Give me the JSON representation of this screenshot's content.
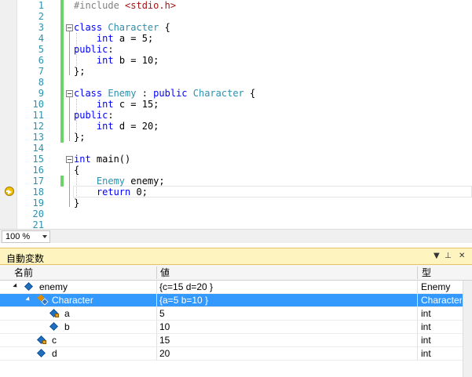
{
  "editor": {
    "lines": [
      {
        "n": "1",
        "segs": [
          {
            "t": "#include ",
            "c": "#808080"
          },
          {
            "t": "<stdio.h>",
            "c": "#a31515"
          }
        ]
      },
      {
        "n": "2",
        "segs": []
      },
      {
        "n": "3",
        "segs": [
          {
            "t": "class ",
            "c": "#0000ff"
          },
          {
            "t": "Character",
            "c": "#2b91af"
          },
          {
            "t": " {",
            "c": "#000000"
          }
        ]
      },
      {
        "n": "4",
        "segs": [
          {
            "t": "    ",
            "c": "#000000"
          },
          {
            "t": "int",
            "c": "#0000ff"
          },
          {
            "t": " a = 5;",
            "c": "#000000"
          }
        ]
      },
      {
        "n": "5",
        "segs": [
          {
            "t": "public",
            "c": "#0000ff"
          },
          {
            "t": ":",
            "c": "#000000"
          }
        ]
      },
      {
        "n": "6",
        "segs": [
          {
            "t": "    ",
            "c": "#000000"
          },
          {
            "t": "int",
            "c": "#0000ff"
          },
          {
            "t": " b = 10;",
            "c": "#000000"
          }
        ]
      },
      {
        "n": "7",
        "segs": [
          {
            "t": "};",
            "c": "#000000"
          }
        ]
      },
      {
        "n": "8",
        "segs": []
      },
      {
        "n": "9",
        "segs": [
          {
            "t": "class ",
            "c": "#0000ff"
          },
          {
            "t": "Enemy",
            "c": "#2b91af"
          },
          {
            "t": " : ",
            "c": "#000000"
          },
          {
            "t": "public ",
            "c": "#0000ff"
          },
          {
            "t": "Character",
            "c": "#2b91af"
          },
          {
            "t": " {",
            "c": "#000000"
          }
        ]
      },
      {
        "n": "10",
        "segs": [
          {
            "t": "    ",
            "c": "#000000"
          },
          {
            "t": "int",
            "c": "#0000ff"
          },
          {
            "t": " c = 15;",
            "c": "#000000"
          }
        ]
      },
      {
        "n": "11",
        "segs": [
          {
            "t": "public",
            "c": "#0000ff"
          },
          {
            "t": ":",
            "c": "#000000"
          }
        ]
      },
      {
        "n": "12",
        "segs": [
          {
            "t": "    ",
            "c": "#000000"
          },
          {
            "t": "int",
            "c": "#0000ff"
          },
          {
            "t": " d = 20;",
            "c": "#000000"
          }
        ]
      },
      {
        "n": "13",
        "segs": [
          {
            "t": "};",
            "c": "#000000"
          }
        ]
      },
      {
        "n": "14",
        "segs": []
      },
      {
        "n": "15",
        "segs": [
          {
            "t": "int",
            "c": "#0000ff"
          },
          {
            "t": " main()",
            "c": "#000000"
          }
        ]
      },
      {
        "n": "16",
        "segs": [
          {
            "t": "{",
            "c": "#000000"
          }
        ]
      },
      {
        "n": "17",
        "segs": [
          {
            "t": "    ",
            "c": "#000000"
          },
          {
            "t": "Enemy",
            "c": "#2b91af"
          },
          {
            "t": " enemy;",
            "c": "#000000"
          }
        ]
      },
      {
        "n": "18",
        "segs": [
          {
            "t": "    ",
            "c": "#000000"
          },
          {
            "t": "return",
            "c": "#0000ff"
          },
          {
            "t": " 0;",
            "c": "#000000"
          }
        ]
      },
      {
        "n": "19",
        "segs": [
          {
            "t": "}",
            "c": "#000000"
          }
        ]
      },
      {
        "n": "20",
        "segs": []
      },
      {
        "n": "21",
        "segs": []
      }
    ],
    "zoom": "100 %"
  },
  "autos": {
    "title": "自動変数",
    "pin_icon": "pin-icon",
    "close_icon": "close-icon",
    "columns": {
      "name": "名前",
      "value": "値",
      "type": "型"
    },
    "rows": [
      {
        "name": "enemy",
        "value": "{c=15 d=20 }",
        "type": "Enemy",
        "icon": "object-icon",
        "selected": false
      },
      {
        "name": "Character",
        "value": "{a=5 b=10 }",
        "type": "Character",
        "icon": "base-class-icon",
        "selected": true
      },
      {
        "name": "a",
        "value": "5",
        "type": "int",
        "icon": "private-field-icon",
        "selected": false
      },
      {
        "name": "b",
        "value": "10",
        "type": "int",
        "icon": "field-icon",
        "selected": false
      },
      {
        "name": "c",
        "value": "15",
        "type": "int",
        "icon": "private-field-icon",
        "selected": false
      },
      {
        "name": "d",
        "value": "20",
        "type": "int",
        "icon": "field-icon",
        "selected": false
      }
    ],
    "colors": {
      "selection": "#3399ff",
      "title_bg": "#fdf4bf"
    }
  }
}
